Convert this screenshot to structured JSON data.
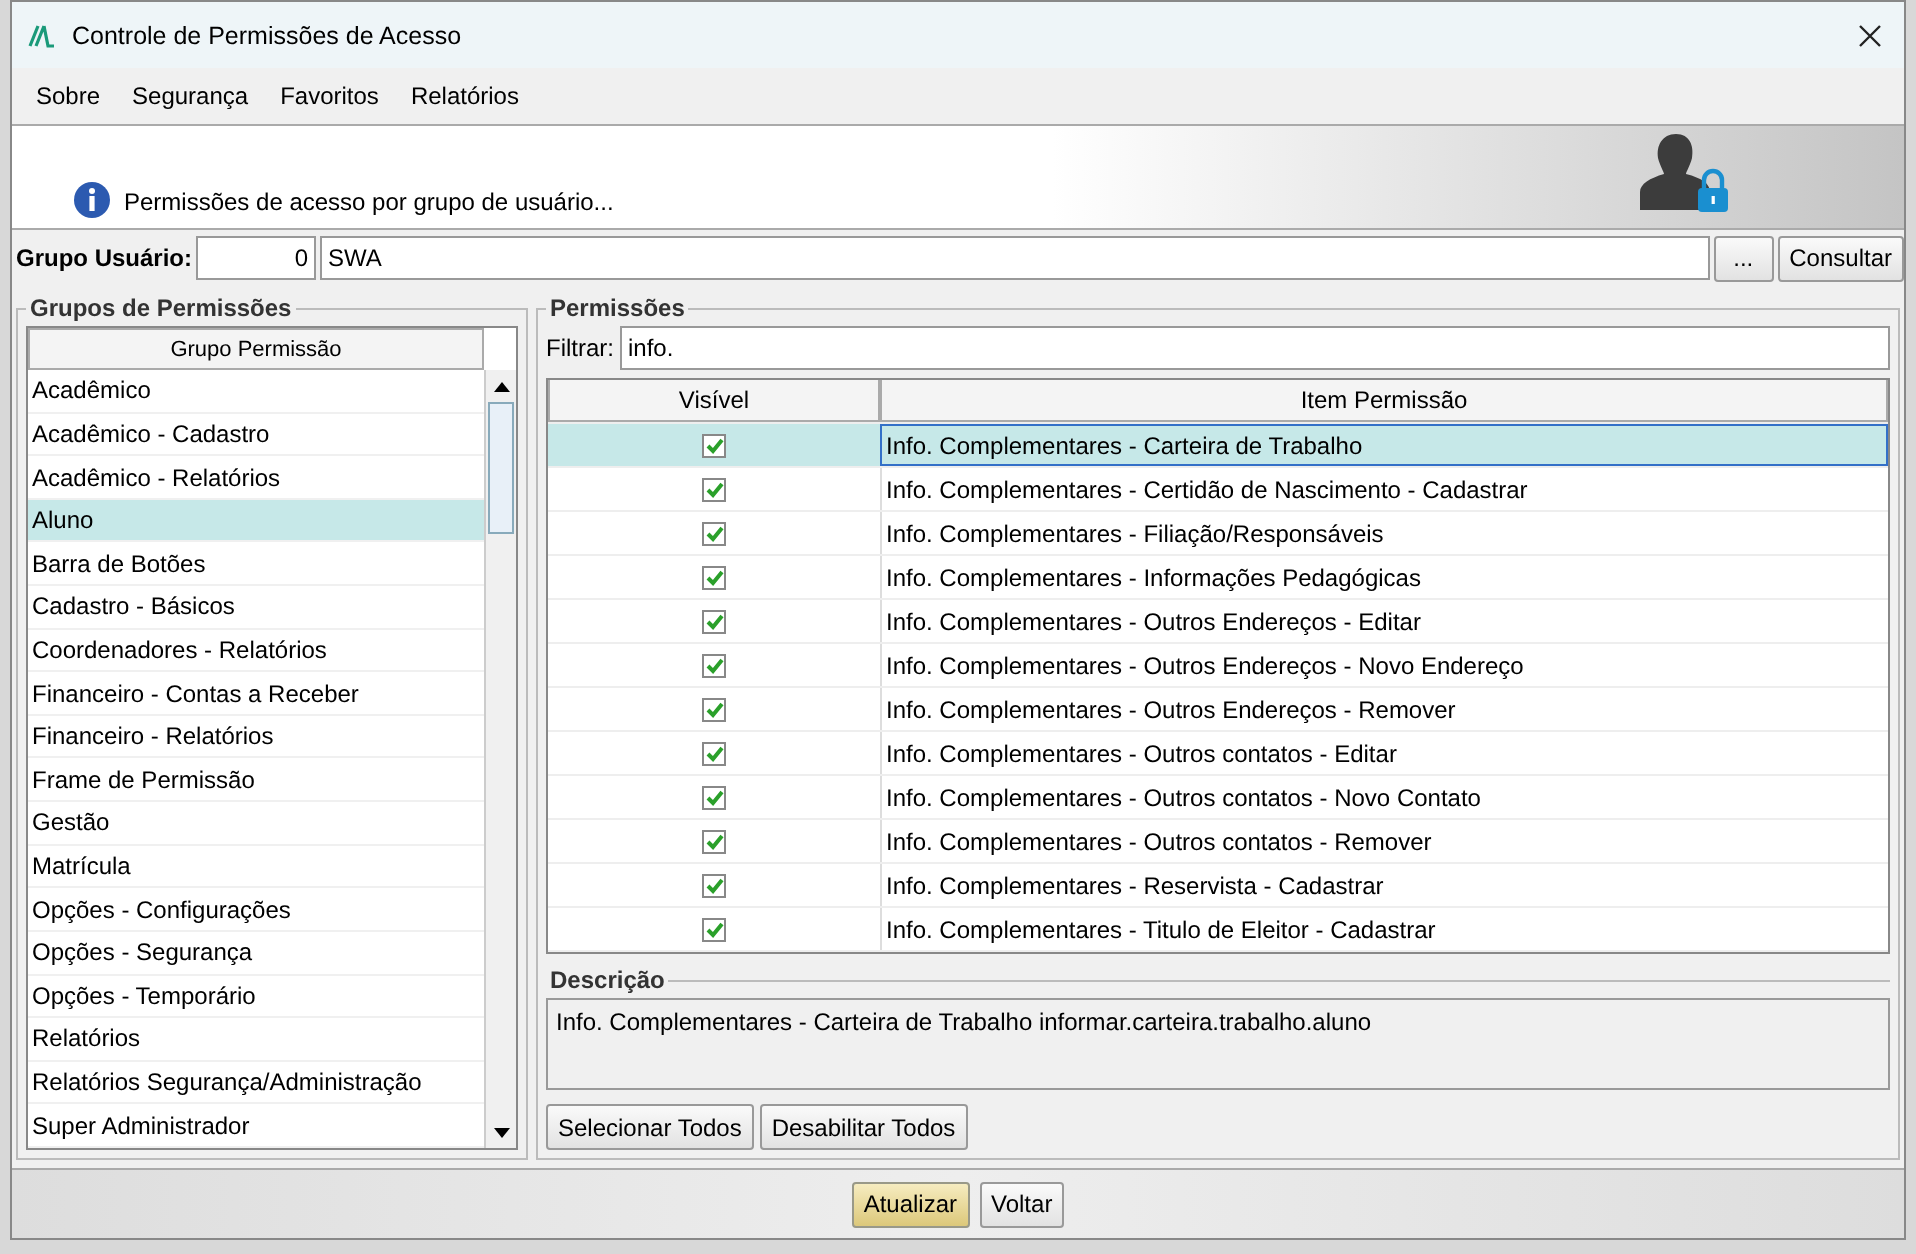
{
  "window": {
    "title": "Controle de Permissões de Acesso"
  },
  "menu": [
    "Sobre",
    "Segurança",
    "Favoritos",
    "Relatórios"
  ],
  "banner": {
    "message": "Permissões de acesso por grupo de usuário..."
  },
  "user_group": {
    "label": "Grupo Usuário:",
    "code": "0",
    "name": "SWA",
    "browse_button": "...",
    "query_button": "Consultar"
  },
  "groups_panel": {
    "title": "Grupos de Permissões",
    "column": "Grupo Permissão",
    "items": [
      {
        "label": "Acadêmico",
        "selected": false
      },
      {
        "label": "Acadêmico - Cadastro",
        "selected": false
      },
      {
        "label": "Acadêmico - Relatórios",
        "selected": false
      },
      {
        "label": "Aluno",
        "selected": true
      },
      {
        "label": "Barra de Botões",
        "selected": false
      },
      {
        "label": "Cadastro - Básicos",
        "selected": false
      },
      {
        "label": "Coordenadores - Relatórios",
        "selected": false
      },
      {
        "label": "Financeiro - Contas a Receber",
        "selected": false
      },
      {
        "label": "Financeiro - Relatórios",
        "selected": false
      },
      {
        "label": "Frame de Permissão",
        "selected": false
      },
      {
        "label": "Gestão",
        "selected": false
      },
      {
        "label": "Matrícula",
        "selected": false
      },
      {
        "label": "Opções - Configurações",
        "selected": false
      },
      {
        "label": "Opções - Segurança",
        "selected": false
      },
      {
        "label": "Opções - Temporário",
        "selected": false
      },
      {
        "label": "Relatórios",
        "selected": false
      },
      {
        "label": "Relatórios Segurança/Administração",
        "selected": false
      },
      {
        "label": "Super Administrador",
        "selected": false
      }
    ]
  },
  "permissions_panel": {
    "title": "Permissões",
    "filter_label": "Filtrar:",
    "filter_value": "info.",
    "columns": [
      "Visível",
      "Item Permissão"
    ],
    "rows": [
      {
        "checked": true,
        "item": "Info. Complementares - Carteira de Trabalho",
        "selected": true
      },
      {
        "checked": true,
        "item": "Info. Complementares - Certidão de Nascimento - Cadastrar",
        "selected": false
      },
      {
        "checked": true,
        "item": "Info. Complementares - Filiação/Responsáveis",
        "selected": false
      },
      {
        "checked": true,
        "item": "Info. Complementares - Informações Pedagógicas",
        "selected": false
      },
      {
        "checked": true,
        "item": "Info. Complementares - Outros Endereços - Editar",
        "selected": false
      },
      {
        "checked": true,
        "item": "Info. Complementares - Outros Endereços - Novo Endereço",
        "selected": false
      },
      {
        "checked": true,
        "item": "Info. Complementares - Outros Endereços - Remover",
        "selected": false
      },
      {
        "checked": true,
        "item": "Info. Complementares - Outros contatos - Editar",
        "selected": false
      },
      {
        "checked": true,
        "item": "Info. Complementares - Outros contatos - Novo Contato",
        "selected": false
      },
      {
        "checked": true,
        "item": "Info. Complementares - Outros contatos - Remover",
        "selected": false
      },
      {
        "checked": true,
        "item": "Info. Complementares - Reservista - Cadastrar",
        "selected": false
      },
      {
        "checked": true,
        "item": "Info. Complementares - Titulo de Eleitor - Cadastrar",
        "selected": false
      }
    ],
    "description": {
      "title": "Descrição",
      "text": "Info. Complementares - Carteira de Trabalho informar.carteira.trabalho.aluno"
    },
    "buttons": [
      "Selecionar Todos",
      "Desabilitar Todos"
    ]
  },
  "footer_buttons": [
    {
      "label": "Atualizar",
      "default": true
    },
    {
      "label": "Voltar",
      "default": false
    }
  ]
}
